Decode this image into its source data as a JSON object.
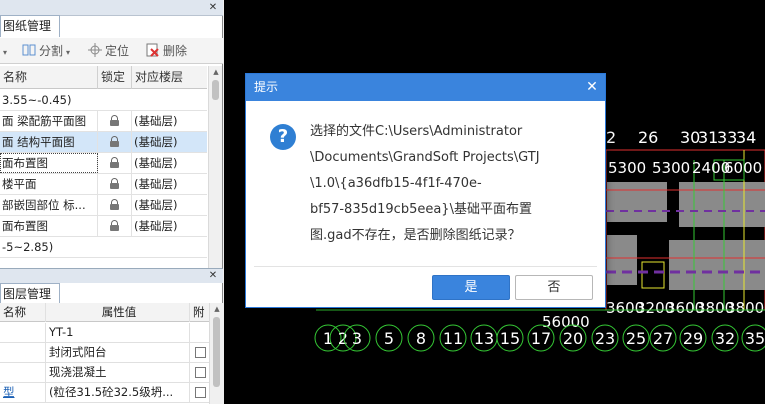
{
  "drawing_panel": {
    "tab": "图纸管理",
    "toolbar": {
      "split": "分割",
      "locate": "定位",
      "delete": "删除"
    },
    "columns": {
      "name": "名称",
      "lock": "锁定",
      "floor": "对应楼层"
    },
    "groups": [
      "3.55~-0.45)",
      "-5~2.85)"
    ],
    "rows": [
      {
        "name": "梁配筋平面图",
        "prefix": "面",
        "floor": "(基础层)"
      },
      {
        "name": "结构平面图",
        "prefix": "面",
        "floor": "(基础层)"
      },
      {
        "name": "面布置图",
        "prefix": "",
        "floor": "(基础层)"
      },
      {
        "name": "楼平面",
        "prefix": "",
        "floor": "(基础层)"
      },
      {
        "name": "部嵌固部位   标...",
        "prefix": "",
        "floor": "(基础层)"
      },
      {
        "name": "面布置图",
        "prefix": "",
        "floor": "(基础层)"
      }
    ]
  },
  "layer_panel": {
    "tab": "图层管理",
    "columns": {
      "name": "名称",
      "value": "属性值",
      "extra": "附"
    },
    "rows": [
      {
        "name": "",
        "value": "YT-1",
        "check": false
      },
      {
        "name": "",
        "value": "封闭式阳台",
        "check": true
      },
      {
        "name": "",
        "value": "现浇混凝土",
        "check": true
      },
      {
        "name": "型",
        "value": "(粒径31.5砼32.5级坍...",
        "check": true
      }
    ]
  },
  "canvas": {
    "top_labels": [
      "2",
      "26",
      "30",
      "31",
      "33",
      "34"
    ],
    "dim_labels": [
      "5300",
      "5300",
      "2400",
      "6000"
    ],
    "mid_dims": [
      "3600",
      "3200",
      "3600",
      "3800",
      "3800"
    ],
    "total_dim": "56000",
    "axis_labels": [
      "1",
      "2",
      "3",
      "5",
      "8",
      "11",
      "13",
      "15",
      "17",
      "20",
      "23",
      "25",
      "27",
      "29",
      "32",
      "35"
    ],
    "colors": {
      "background": "#000000",
      "grid_green": "#35c935",
      "wall_red": "#e03030",
      "fill_gray": "#8a8a8a"
    }
  },
  "dialog": {
    "title": "提示",
    "message_lines": [
      "选择的文件C:\\Users\\Administrator",
      "\\Documents\\GrandSoft Projects\\GTJ",
      "\\1.0\\{a36dfb15-4f1f-470e-",
      "bf57-835d19cb5eea}\\基础平面布置",
      "图.gad不存在，是否删除图纸记录？"
    ],
    "yes": "是",
    "no": "否",
    "accent": "#3a84dd"
  }
}
